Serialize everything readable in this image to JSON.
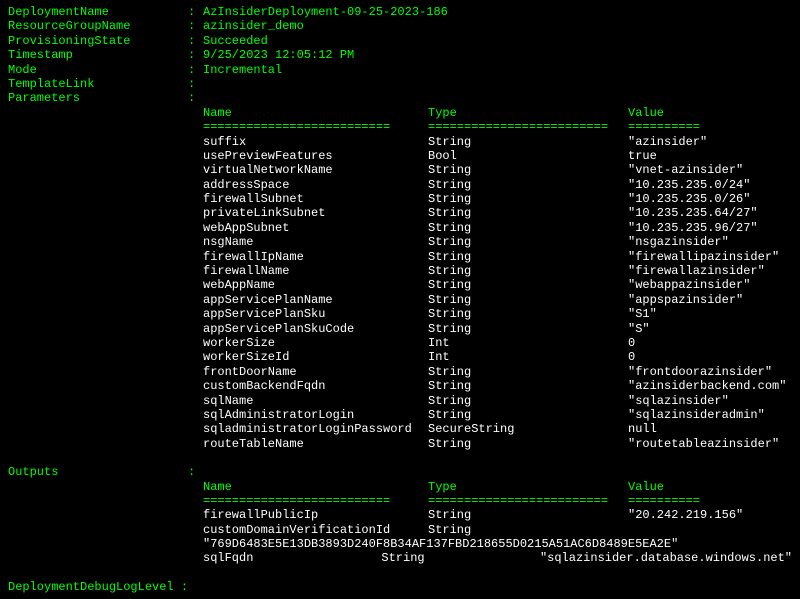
{
  "fields": {
    "deploymentName": {
      "label": "DeploymentName",
      "value": "AzInsiderDeployment-09-25-2023-186"
    },
    "resourceGroupName": {
      "label": "ResourceGroupName",
      "value": "azinsider_demo"
    },
    "provisioningState": {
      "label": "ProvisioningState",
      "value": "Succeeded"
    },
    "timestamp": {
      "label": "Timestamp",
      "value": "9/25/2023 12:05:12 PM"
    },
    "mode": {
      "label": "Mode",
      "value": "Incremental"
    },
    "templateLink": {
      "label": "TemplateLink",
      "value": ""
    },
    "parameters": {
      "label": "Parameters",
      "value": ""
    },
    "outputs": {
      "label": "Outputs",
      "value": ""
    },
    "deploymentDebug": {
      "label": "DeploymentDebugLogLevel",
      "value": ""
    }
  },
  "headers": {
    "name": "Name",
    "type": "Type",
    "value": "Value"
  },
  "underlines": {
    "name": "==========================",
    "type": "=========================",
    "value": "=========="
  },
  "parameters_rows": [
    {
      "name": "suffix",
      "type": "String",
      "value": "\"azinsider\""
    },
    {
      "name": "usePreviewFeatures",
      "type": "Bool",
      "value": "true"
    },
    {
      "name": "virtualNetworkName",
      "type": "String",
      "value": "\"vnet-azinsider\""
    },
    {
      "name": "addressSpace",
      "type": "String",
      "value": "\"10.235.235.0/24\""
    },
    {
      "name": "firewallSubnet",
      "type": "String",
      "value": "\"10.235.235.0/26\""
    },
    {
      "name": "privateLinkSubnet",
      "type": "String",
      "value": "\"10.235.235.64/27\""
    },
    {
      "name": "webAppSubnet",
      "type": "String",
      "value": "\"10.235.235.96/27\""
    },
    {
      "name": "nsgName",
      "type": "String",
      "value": "\"nsgazinsider\""
    },
    {
      "name": "firewallIpName",
      "type": "String",
      "value": "\"firewallipazinsider\""
    },
    {
      "name": "firewallName",
      "type": "String",
      "value": "\"firewallazinsider\""
    },
    {
      "name": "webAppName",
      "type": "String",
      "value": "\"webappazinsider\""
    },
    {
      "name": "appServicePlanName",
      "type": "String",
      "value": "\"appspazinsider\""
    },
    {
      "name": "appServicePlanSku",
      "type": "String",
      "value": "\"S1\""
    },
    {
      "name": "appServicePlanSkuCode",
      "type": "String",
      "value": "\"S\""
    },
    {
      "name": "workerSize",
      "type": "Int",
      "value": "0"
    },
    {
      "name": "workerSizeId",
      "type": "Int",
      "value": "0"
    },
    {
      "name": "frontDoorName",
      "type": "String",
      "value": "\"frontdoorazinsider\""
    },
    {
      "name": "customBackendFqdn",
      "type": "String",
      "value": "\"azinsiderbackend.com\""
    },
    {
      "name": "sqlName",
      "type": "String",
      "value": "\"sqlazinsider\""
    },
    {
      "name": "sqlAdministratorLogin",
      "type": "String",
      "value": "\"sqlazinsideradmin\""
    },
    {
      "name": "sqladministratorLoginPassword",
      "type": "SecureString",
      "value": "null"
    },
    {
      "name": "routeTableName",
      "type": "String",
      "value": "\"routetableazinsider\""
    }
  ],
  "outputs_rows": [
    {
      "name": "firewallPublicIp",
      "type": "String",
      "value": "\"20.242.219.156\""
    },
    {
      "name": "customDomainVerificationId",
      "type": "String",
      "value": ""
    }
  ],
  "long_verification_id": "\"769D6483E5E13DB3893D240F8B34AF137FBD218655D0215A51AC6D8489E5EA2E\"",
  "outputs_rows2": [
    {
      "name": "sqlFqdn",
      "type": "String",
      "value": "\"sqlazinsider.database.windows.net\""
    }
  ]
}
